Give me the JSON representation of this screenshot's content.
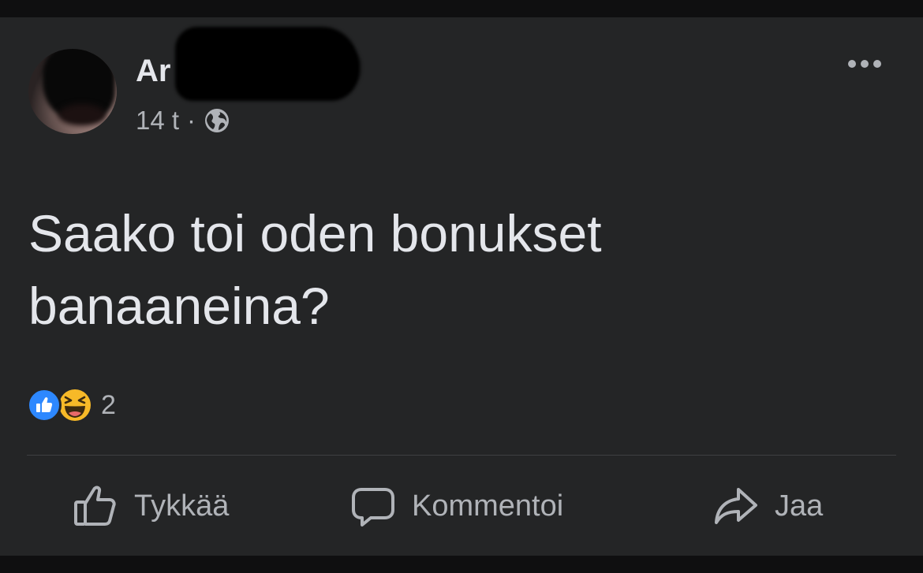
{
  "post": {
    "author_name": "Ar",
    "timestamp": "14 t",
    "separator": "·",
    "audience_icon": "globe-icon",
    "text": "Saako toi oden bonukset banaaneina?",
    "reactions": {
      "types": [
        "like",
        "haha"
      ],
      "count": "2"
    }
  },
  "actions": {
    "like_label": "Tykkää",
    "comment_label": "Kommentoi",
    "share_label": "Jaa"
  },
  "colors": {
    "card_background": "#242526",
    "text_primary": "#e4e6eb",
    "text_secondary": "#b0b3b8",
    "like_blue": "#2d88ff",
    "haha_yellow": "#f7b928"
  }
}
